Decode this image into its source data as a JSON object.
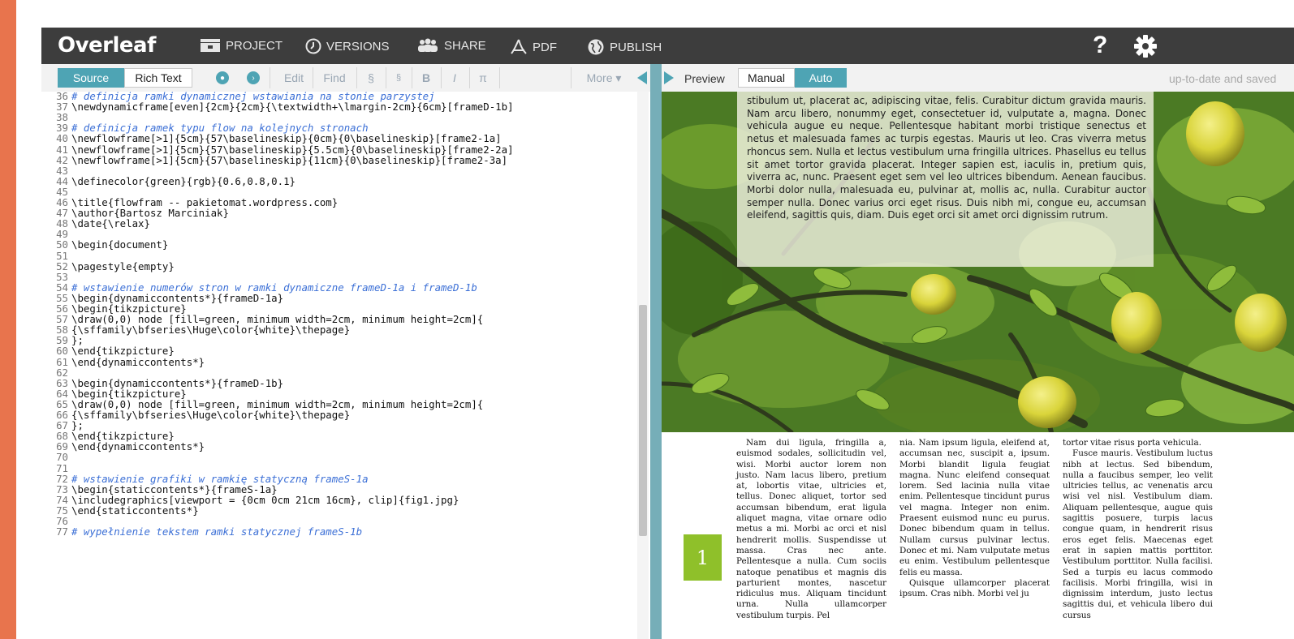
{
  "header": {
    "logo": "Overleaf",
    "nav": [
      {
        "label": "PROJECT",
        "icon": "folder-icon"
      },
      {
        "label": "VERSIONS",
        "icon": "clock-icon"
      },
      {
        "label": "SHARE",
        "icon": "users-icon"
      },
      {
        "label": "PDF",
        "icon": "pdf-icon"
      },
      {
        "label": "PUBLISH",
        "icon": "globe-icon"
      }
    ],
    "help": "?"
  },
  "editor_toolbar": {
    "source": "Source",
    "rich_text": "Rich Text",
    "edit": "Edit",
    "find": "Find",
    "section": "§",
    "subsection": "§",
    "bold": "B",
    "italic": "I",
    "math": "π",
    "more": "More ▾"
  },
  "code": [
    {
      "n": "36",
      "t": "# definicja ramki dynamicznej wstawiania na stonie parzystej",
      "c": true
    },
    {
      "n": "37",
      "t": "\\newdynamicframe[even]{2cm}{2cm}{\\textwidth+\\lmargin-2cm}{6cm}[frameD-1b]"
    },
    {
      "n": "38",
      "t": ""
    },
    {
      "n": "39",
      "t": "# definicja ramek typu flow na kolejnych stronach",
      "c": true
    },
    {
      "n": "40",
      "t": "\\newflowframe[>1]{5cm}{57\\baselineskip}{0cm}{0\\baselineskip}[frame2-1a]"
    },
    {
      "n": "41",
      "t": "\\newflowframe[>1]{5cm}{57\\baselineskip}{5.5cm}{0\\baselineskip}[frame2-2a]"
    },
    {
      "n": "42",
      "t": "\\newflowframe[>1]{5cm}{57\\baselineskip}{11cm}{0\\baselineskip}[frame2-3a]"
    },
    {
      "n": "43",
      "t": ""
    },
    {
      "n": "44",
      "t": "\\definecolor{green}{rgb}{0.6,0.8,0.1}"
    },
    {
      "n": "45",
      "t": ""
    },
    {
      "n": "46",
      "t": "\\title{flowfram -- pakietomat.wordpress.com}"
    },
    {
      "n": "47",
      "t": "\\author{Bartosz Marciniak}"
    },
    {
      "n": "48",
      "t": "\\date{\\relax}"
    },
    {
      "n": "49",
      "t": ""
    },
    {
      "n": "50",
      "t": "\\begin{document}"
    },
    {
      "n": "51",
      "t": ""
    },
    {
      "n": "52",
      "t": "\\pagestyle{empty}"
    },
    {
      "n": "53",
      "t": ""
    },
    {
      "n": "54",
      "t": "# wstawienie numerów stron w ramki dynamiczne frameD-1a i frameD-1b",
      "c": true
    },
    {
      "n": "55",
      "t": "\\begin{dynamiccontents*}{frameD-1a}"
    },
    {
      "n": "56",
      "t": "\\begin{tikzpicture}"
    },
    {
      "n": "57",
      "t": "\\draw(0,0) node [fill=green, minimum width=2cm, minimum height=2cm]{"
    },
    {
      "n": "58",
      "t": "{\\sffamily\\bfseries\\Huge\\color{white}\\thepage}"
    },
    {
      "n": "59",
      "t": "};"
    },
    {
      "n": "60",
      "t": "\\end{tikzpicture}"
    },
    {
      "n": "61",
      "t": "\\end{dynamiccontents*}"
    },
    {
      "n": "62",
      "t": ""
    },
    {
      "n": "63",
      "t": "\\begin{dynamiccontents*}{frameD-1b}"
    },
    {
      "n": "64",
      "t": "\\begin{tikzpicture}"
    },
    {
      "n": "65",
      "t": "\\draw(0,0) node [fill=green, minimum width=2cm, minimum height=2cm]{"
    },
    {
      "n": "66",
      "t": "{\\sffamily\\bfseries\\Huge\\color{white}\\thepage}"
    },
    {
      "n": "67",
      "t": "};"
    },
    {
      "n": "68",
      "t": "\\end{tikzpicture}"
    },
    {
      "n": "69",
      "t": "\\end{dynamiccontents*}"
    },
    {
      "n": "70",
      "t": ""
    },
    {
      "n": "71",
      "t": ""
    },
    {
      "n": "72",
      "t": "# wstawienie grafiki w ramkię statyczną frameS-1a",
      "c": true
    },
    {
      "n": "73",
      "t": "\\begin{staticcontents*}{frameS-1a}"
    },
    {
      "n": "74",
      "t": "\\includegraphics[viewport = {0cm 0cm 21cm 16cm}, clip]{fig1.jpg}"
    },
    {
      "n": "75",
      "t": "\\end{staticcontents*}"
    },
    {
      "n": "76",
      "t": ""
    },
    {
      "n": "77",
      "t": "# wypełnienie tekstem ramki statycznej frameS-1b",
      "c": true
    }
  ],
  "preview_toolbar": {
    "preview": "Preview",
    "manual": "Manual",
    "auto": "Auto",
    "status": "up-to-date and saved"
  },
  "pdf": {
    "overlay_text": "stibulum ut, placerat ac, adipiscing vitae, felis. Curabitur dictum gravida mauris. Nam arcu libero, nonummy eget, consectetuer id, vulputate a, magna. Donec vehicula augue eu neque. Pellentesque habitant morbi tristique senectus et netus et malesuada fames ac turpis egestas. Mauris ut leo. Cras viverra metus rhoncus sem. Nulla et lectus vestibulum urna fringilla ultrices. Phasellus eu tellus sit amet tortor gravida placerat. Integer sapien est, iaculis in, pretium quis, viverra ac, nunc. Praesent eget sem vel leo ultrices bibendum. Aenean faucibus. Morbi dolor nulla, malesuada eu, pulvinar at, mollis ac, nulla. Curabitur auctor semper nulla. Donec varius orci eget risus. Duis nibh mi, congue eu, accumsan eleifend, sagittis quis, diam. Duis eget orci sit amet orci dignissim rutrum.",
    "page_number": "1",
    "col1": "Nam dui ligula, fringilla a, euismod sodales, sollicitudin vel, wisi. Morbi auctor lorem non justo. Nam lacus libero, pretium at, lobortis vitae, ultricies et, tellus. Donec aliquet, tortor sed accumsan bibendum, erat ligula aliquet magna, vitae ornare odio metus a mi. Morbi ac orci et nisl hendrerit mollis. Suspendisse ut massa. Cras nec ante. Pellentesque a nulla. Cum sociis natoque penatibus et magnis dis parturient montes, nascetur ridiculus mus. Aliquam tincidunt urna. Nulla ullamcorper vestibulum turpis. Pel",
    "col2a": "nia. Nam ipsum ligula, eleifend at, accumsan nec, suscipit a, ipsum. Morbi blandit ligula feugiat magna. Nunc eleifend consequat lorem. Sed lacinia nulla vitae enim. Pellentesque tincidunt purus vel magna. Integer non enim. Praesent euismod nunc eu purus. Donec bibendum quam in tellus. Nullam cursus pulvinar lectus. Donec et mi. Nam vulputate metus eu enim. Vestibulum pellentesque felis eu massa.",
    "col2b": "Quisque ullamcorper placerat ipsum. Cras nibh. Morbi vel ju",
    "col3a": "tortor vitae risus porta vehicula.",
    "col3b": "Fusce mauris. Vestibulum luctus nibh at lectus. Sed bibendum, nulla a faucibus semper, leo velit ultricies tellus, ac venenatis arcu wisi vel nisl. Vestibulum diam. Aliquam pellentesque, augue quis sagittis posuere, turpis lacus congue quam, in hendrerit risus eros eget felis. Maecenas eget erat in sapien mattis porttitor. Vestibulum porttitor. Nulla facilisi. Sed a turpis eu lacus commodo facilisis. Morbi fringilla, wisi in dignissim interdum, justo lectus sagittis dui, et vehicula libero dui cursus"
  }
}
